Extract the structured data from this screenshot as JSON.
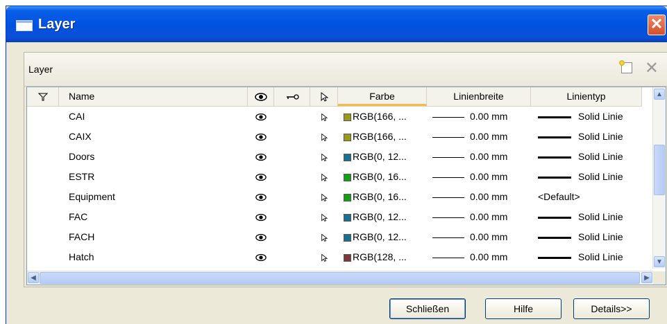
{
  "window": {
    "title": "Layer"
  },
  "group": {
    "label": "Layer"
  },
  "columns": [
    "Name",
    "Farbe",
    "Linienbreite",
    "Linientyp"
  ],
  "layers": [
    {
      "name": "CAI",
      "color": "RGB(166, ...",
      "swatch": "#9a9a1a",
      "width": "0.00 mm",
      "linetype": "Solid Linie",
      "solid": true
    },
    {
      "name": "CAIX",
      "color": "RGB(166, ...",
      "swatch": "#9a9a1a",
      "width": "0.00 mm",
      "linetype": "Solid Linie",
      "solid": true
    },
    {
      "name": "Doors",
      "color": "RGB(0, 12...",
      "swatch": "#1a7090",
      "width": "0.00 mm",
      "linetype": "Solid Linie",
      "solid": true
    },
    {
      "name": "ESTR",
      "color": "RGB(0, 16...",
      "swatch": "#14a014",
      "width": "0.00 mm",
      "linetype": "Solid Linie",
      "solid": true
    },
    {
      "name": "Equipment",
      "color": "RGB(0, 16...",
      "swatch": "#14a014",
      "width": "0.00 mm",
      "linetype": "<Default>",
      "solid": false
    },
    {
      "name": "FAC",
      "color": "RGB(0, 12...",
      "swatch": "#1a7090",
      "width": "0.00 mm",
      "linetype": "Solid Linie",
      "solid": true
    },
    {
      "name": "FACH",
      "color": "RGB(0, 12...",
      "swatch": "#1a7090",
      "width": "0.00 mm",
      "linetype": "Solid Linie",
      "solid": true
    },
    {
      "name": "Hatch",
      "color": "RGB(128, ...",
      "swatch": "#7a3a3a",
      "width": "0.00 mm",
      "linetype": "Solid Linie",
      "solid": true
    }
  ],
  "buttons": {
    "close": "Schließen",
    "help": "Hilfe",
    "details": "Details>>"
  }
}
